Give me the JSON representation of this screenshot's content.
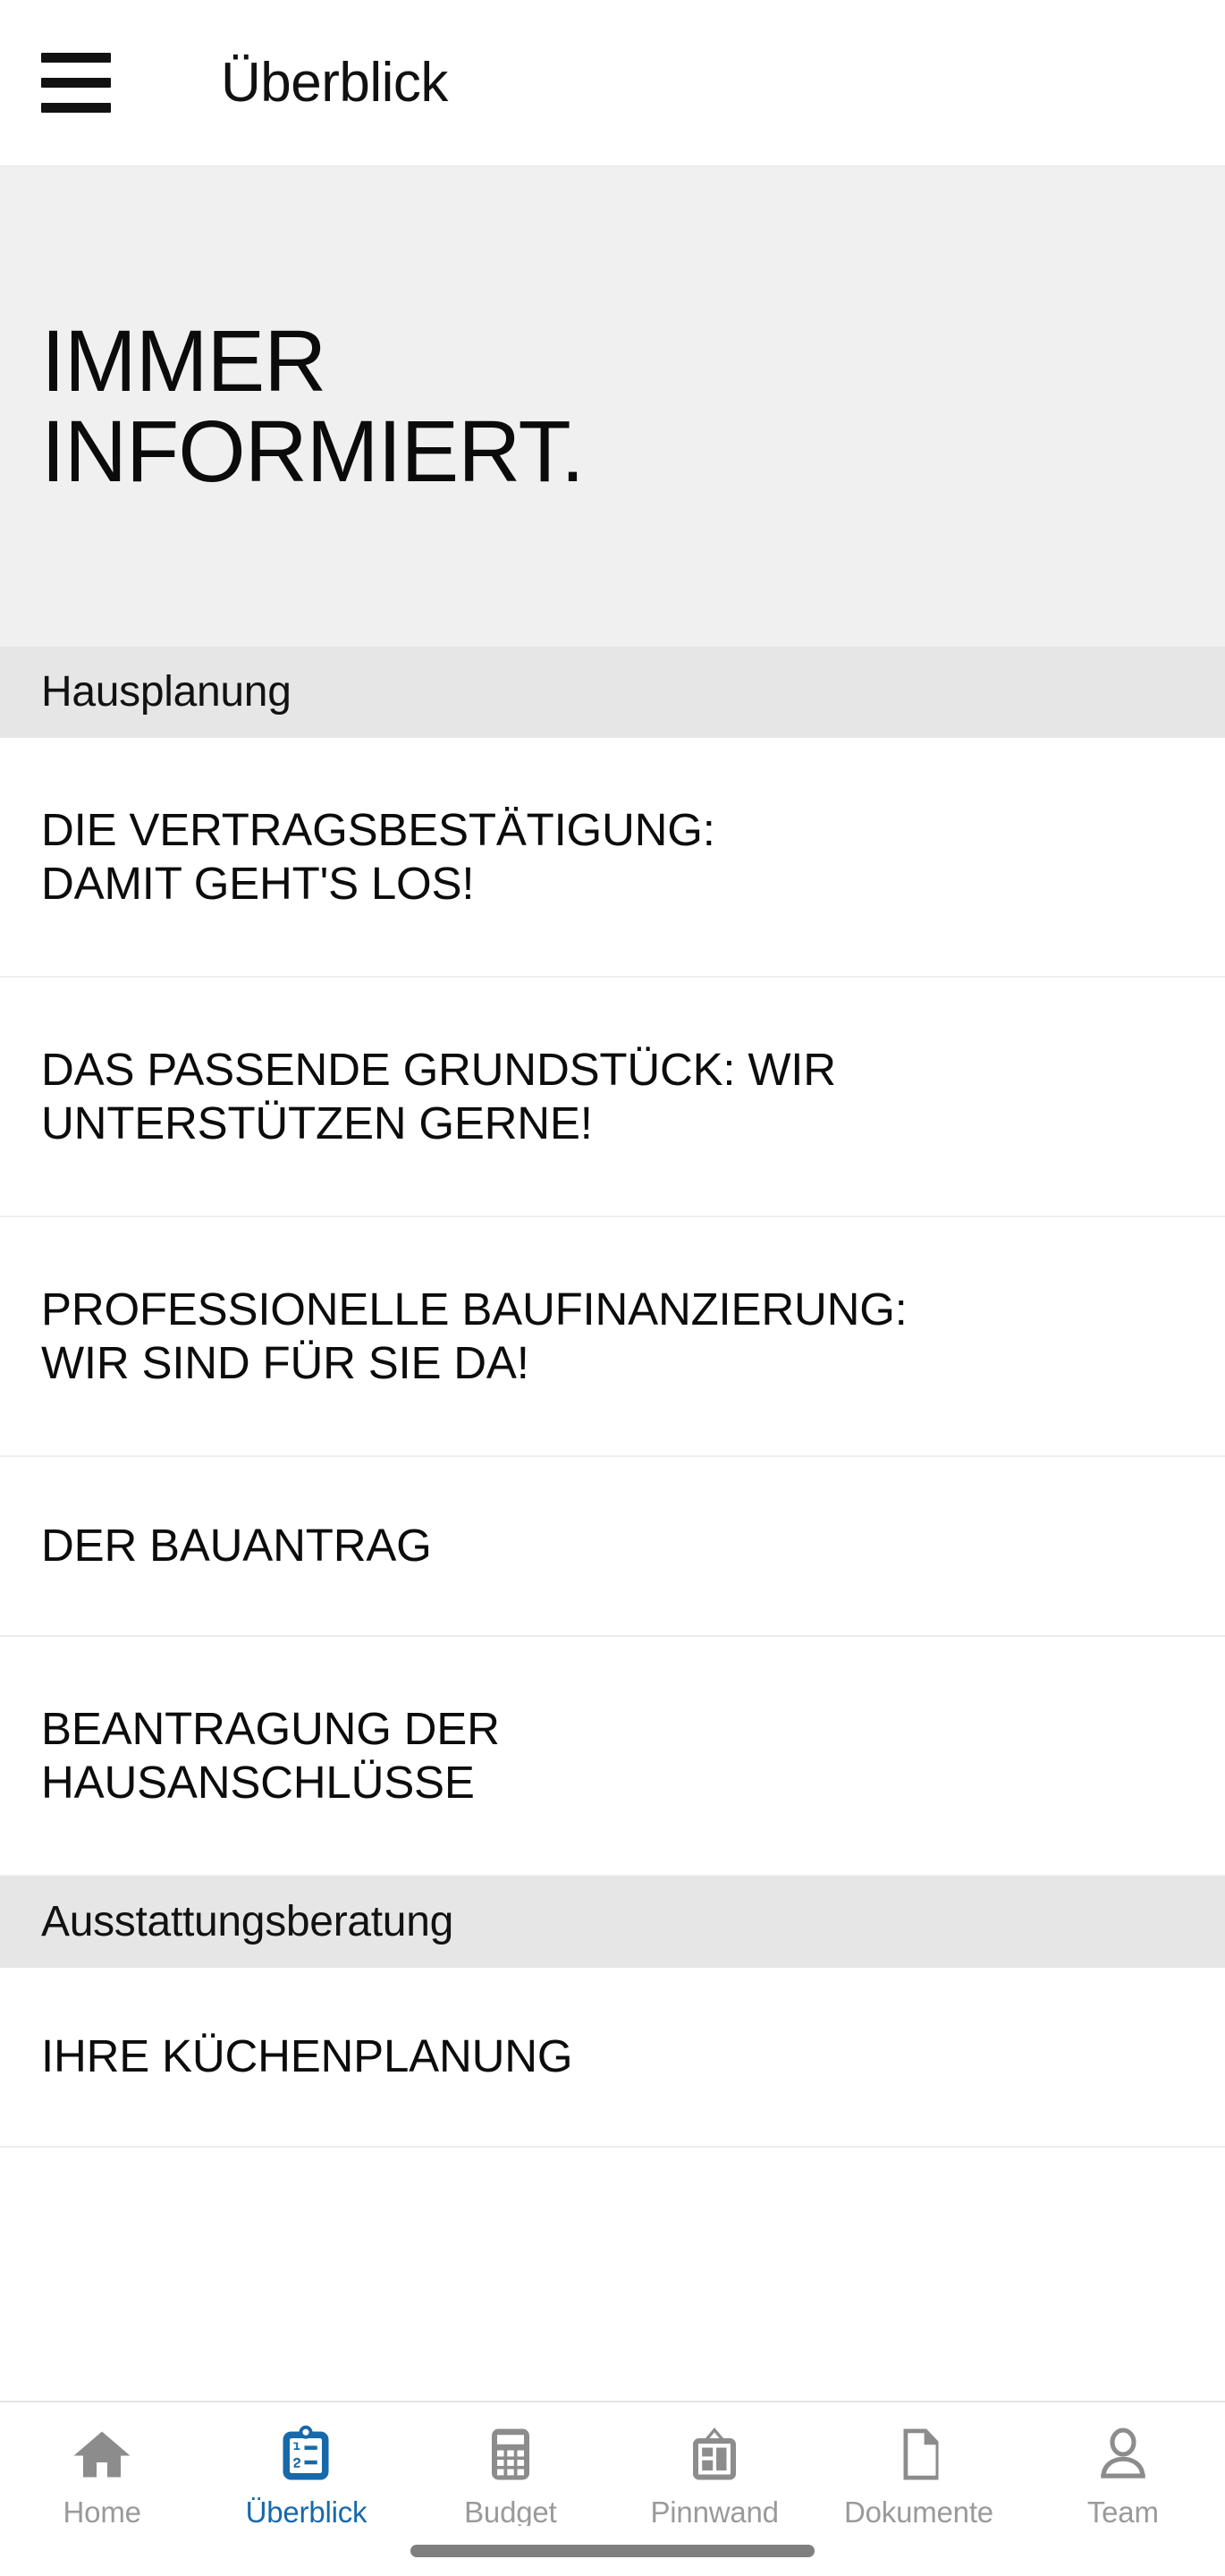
{
  "appbar": {
    "menu_icon": "hamburger-menu-icon",
    "title": "Überblick"
  },
  "hero": {
    "title": "IMMER\nINFORMIERT."
  },
  "sections": [
    {
      "id": "hausplanung",
      "title": "Hausplanung",
      "items": [
        {
          "label": "DIE VERTRAGSBESTÄTIGUNG:\nDAMIT GEHT'S LOS!",
          "lines": 2
        },
        {
          "label": "DAS PASSENDE GRUNDSTÜCK: WIR\nUNTERSTÜTZEN GERNE!",
          "lines": 2
        },
        {
          "label": "PROFESSIONELLE BAUFINANZIERUNG:\nWIR SIND FÜR SIE DA!",
          "lines": 2
        },
        {
          "label": "DER BAUANTRAG",
          "lines": 1
        },
        {
          "label": "BEANTRAGUNG DER\nHAUSANSCHLÜSSE",
          "lines": 2
        }
      ]
    },
    {
      "id": "ausstattungsberatung",
      "title": "Ausstattungsberatung",
      "items": [
        {
          "label": "IHRE KÜCHENPLANUNG",
          "lines": 1
        }
      ]
    }
  ],
  "tabbar": {
    "active_color": "#1769aa",
    "inactive_color": "#9a9a9a",
    "tabs": [
      {
        "id": "home",
        "label": "Home",
        "icon": "home-icon",
        "active": false
      },
      {
        "id": "ueberblick",
        "label": "Überblick",
        "icon": "clipboard-list-icon",
        "active": true
      },
      {
        "id": "budget",
        "label": "Budget",
        "icon": "calculator-icon",
        "active": false
      },
      {
        "id": "pinnwand",
        "label": "Pinnwand",
        "icon": "pinboard-icon",
        "active": false
      },
      {
        "id": "dokumente",
        "label": "Dokumente",
        "icon": "document-icon",
        "active": false
      },
      {
        "id": "team",
        "label": "Team",
        "icon": "person-icon",
        "active": false
      }
    ]
  }
}
